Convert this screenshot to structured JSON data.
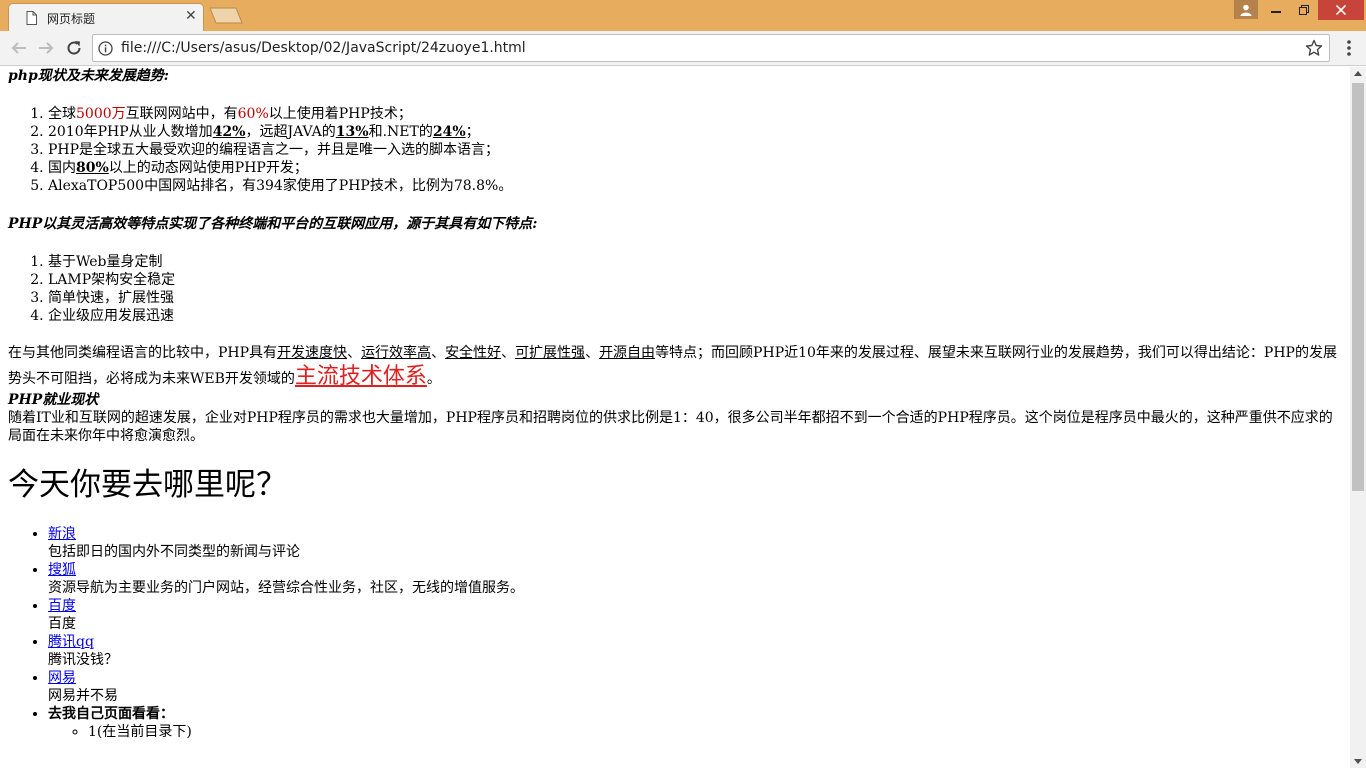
{
  "tab": {
    "title": "网页标题",
    "close": "✕"
  },
  "address": {
    "url": "file:///C:/Users/asus/Desktop/02/JavaScript/24zuoye1.html"
  },
  "content": {
    "heading1": "php现状及未来发展趋势:",
    "list1": [
      {
        "a": "全球",
        "b": "5000万",
        "c": "互联网网站中，有",
        "d": "60%",
        "e": "以上使用着PHP技术；"
      },
      {
        "a": "2010年PHP从业人数增加",
        "b": "42%",
        "c": "，远超JAVA的",
        "d": "13%",
        "e": "和.NET的",
        "f": "24%",
        "g": "；"
      },
      {
        "text": "PHP是全球五大最受欢迎的编程语言之一，并且是唯一入选的脚本语言；"
      },
      {
        "a": "国内",
        "b": "80%",
        "c": "以上的动态网站使用PHP开发；"
      },
      {
        "text": "AlexaTOP500中国网站排名，有394家使用了PHP技术，比例为78.8%。"
      }
    ],
    "heading2": "PHP以其灵活高效等特点实现了各种终端和平台的互联网应用，源于其具有如下特点:",
    "list2": [
      "基于Web量身定制",
      "LAMP架构安全稳定",
      "简单快速，扩展性强",
      "企业级应用发展迅速"
    ],
    "para1": {
      "a": "在与其他同类编程语言的比较中，PHP具有",
      "k1": "开发速度快",
      "s1": "、",
      "k2": "运行效率高",
      "s2": "、",
      "k3": "安全性好",
      "s3": "、",
      "k4": "可扩展性强",
      "s4": "、",
      "k5": "开源自由",
      "b": "等特点；而回顾PHP近10年来的发展过程、展望未来互联网行业的发展趋势，我们可以得出结论：PHP的发展势头不可阻挡，必将成为未来WEB开发领域的",
      "big": "主流技术体系",
      "end": "。"
    },
    "heading3": "PHP就业现状",
    "para2": "随着IT业和互联网的超速发展，企业对PHP程序员的需求也大量增加，PHP程序员和招聘岗位的供求比例是1：40，很多公司半年都招不到一个合适的PHP程序员。这个岗位是程序员中最火的，这种严重供不应求的局面在未来你年中将愈演愈烈。",
    "h1": "今天你要去哪里呢？",
    "sites": [
      {
        "name": "新浪",
        "desc": "包括即日的国内外不同类型的新闻与评论"
      },
      {
        "name": "搜狐",
        "desc": "资源导航为主要业务的门户网站，经营综合性业务，社区，无线的增值服务。"
      },
      {
        "name": "百度",
        "desc": "百度"
      },
      {
        "name": "腾讯qq",
        "desc": "腾讯没钱？"
      },
      {
        "name": "网易",
        "desc": "网易并不易"
      }
    ],
    "last_item": "去我自己页面看看：",
    "cut_line": "1(在当前目录下)"
  },
  "colors": {
    "titlebar": "#e7ac5e",
    "toolbar": "#f2f2f2",
    "red_text": "#c00000",
    "big_red": "#e02020",
    "link": "#0000ee"
  },
  "icons": [
    "page-icon",
    "back-arrow-icon",
    "forward-arrow-icon",
    "reload-icon",
    "info-icon",
    "star-icon",
    "menu-dots-icon",
    "user-icon",
    "minimize-icon",
    "maximize-icon",
    "close-icon"
  ]
}
